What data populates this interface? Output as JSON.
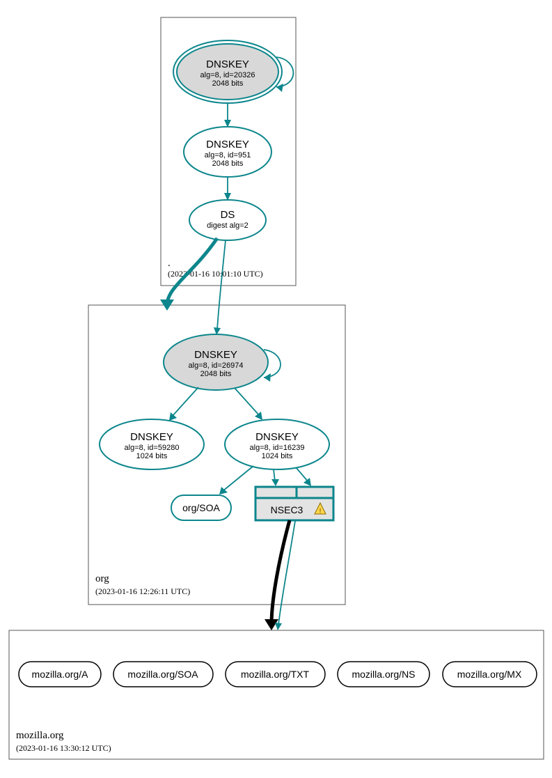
{
  "colors": {
    "teal": "#0c868c",
    "fillGray": "#d8d8d8",
    "nsecFill": "#e3e3e3",
    "black": "#000000"
  },
  "zones": {
    "root": {
      "label": ".",
      "timestamp": "(2023-01-16 10:01:10 UTC)",
      "nodes": {
        "ksk": {
          "title": "DNSKEY",
          "line2": "alg=8, id=20326",
          "line3": "2048 bits"
        },
        "zsk": {
          "title": "DNSKEY",
          "line2": "alg=8, id=951",
          "line3": "2048 bits"
        },
        "ds": {
          "title": "DS",
          "line2": "digest alg=2"
        }
      }
    },
    "org": {
      "label": "org",
      "timestamp": "(2023-01-16 12:26:11 UTC)",
      "nodes": {
        "ksk": {
          "title": "DNSKEY",
          "line2": "alg=8, id=26974",
          "line3": "2048 bits"
        },
        "zsk1": {
          "title": "DNSKEY",
          "line2": "alg=8, id=59280",
          "line3": "1024 bits"
        },
        "zsk2": {
          "title": "DNSKEY",
          "line2": "alg=8, id=16239",
          "line3": "1024 bits"
        },
        "soa": {
          "label": "org/SOA"
        },
        "nsec3": {
          "label": "NSEC3"
        }
      }
    },
    "mozilla": {
      "label": "mozilla.org",
      "timestamp": "(2023-01-16 13:30:12 UTC)",
      "rrsets": [
        "mozilla.org/A",
        "mozilla.org/SOA",
        "mozilla.org/TXT",
        "mozilla.org/NS",
        "mozilla.org/MX"
      ]
    }
  }
}
